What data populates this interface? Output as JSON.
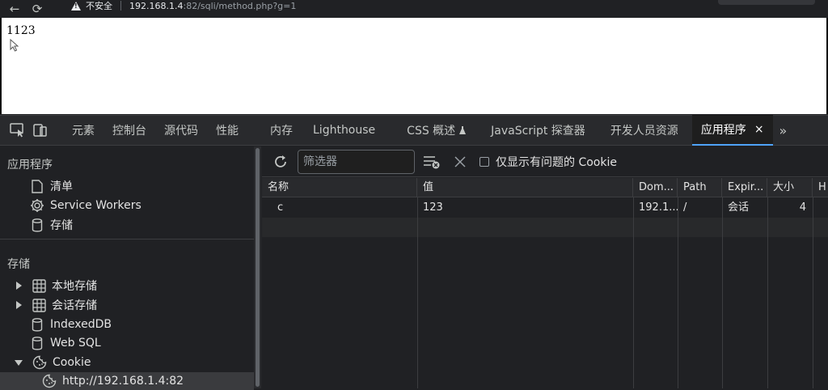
{
  "browser": {
    "insecure_label": "不安全",
    "url_host": "192.168.1.4",
    "url_path": ":82/sqli/method.php?g=1"
  },
  "page": {
    "body_text": "1123"
  },
  "devtools": {
    "tabs": [
      {
        "label": "元素"
      },
      {
        "label": "控制台"
      },
      {
        "label": "源代码"
      },
      {
        "label": "性能"
      },
      {
        "label": "内存"
      },
      {
        "label": "Lighthouse"
      },
      {
        "label": "CSS 概述"
      },
      {
        "label": "JavaScript 探查器"
      },
      {
        "label": "开发人员资源"
      },
      {
        "label": "应用程序"
      }
    ],
    "active_tab_close": "×",
    "more": "»"
  },
  "sidebar": {
    "section_app": "应用程序",
    "app_items": [
      {
        "label": "清单",
        "icon": "file-icon"
      },
      {
        "label": "Service Workers",
        "icon": "gear-icon"
      },
      {
        "label": "存储",
        "icon": "database-icon"
      }
    ],
    "section_storage": "存储",
    "storage_items": [
      {
        "label": "本地存储",
        "icon": "grid-icon"
      },
      {
        "label": "会话存储",
        "icon": "grid-icon"
      },
      {
        "label": "IndexedDB",
        "icon": "database-icon"
      },
      {
        "label": "Web SQL",
        "icon": "database-icon"
      },
      {
        "label": "Cookie",
        "icon": "cookie-icon"
      },
      {
        "label": "http://192.168.1.4:82",
        "icon": "cookie-icon"
      }
    ]
  },
  "toolbar": {
    "filter_placeholder": "筛选器",
    "only_issues_label": "仅显示有问题的 Cookie"
  },
  "cookies_table": {
    "headers": [
      "名称",
      "值",
      "Dom...",
      "Path",
      "Expir...",
      "大小",
      "H"
    ],
    "rows": [
      {
        "name": "c",
        "value": "123",
        "domain": "192.1...",
        "path": "/",
        "expires": "会话",
        "size": "4"
      }
    ]
  },
  "colors": {
    "accent": "#4fa3f7",
    "devtools_bg": "#202124"
  }
}
